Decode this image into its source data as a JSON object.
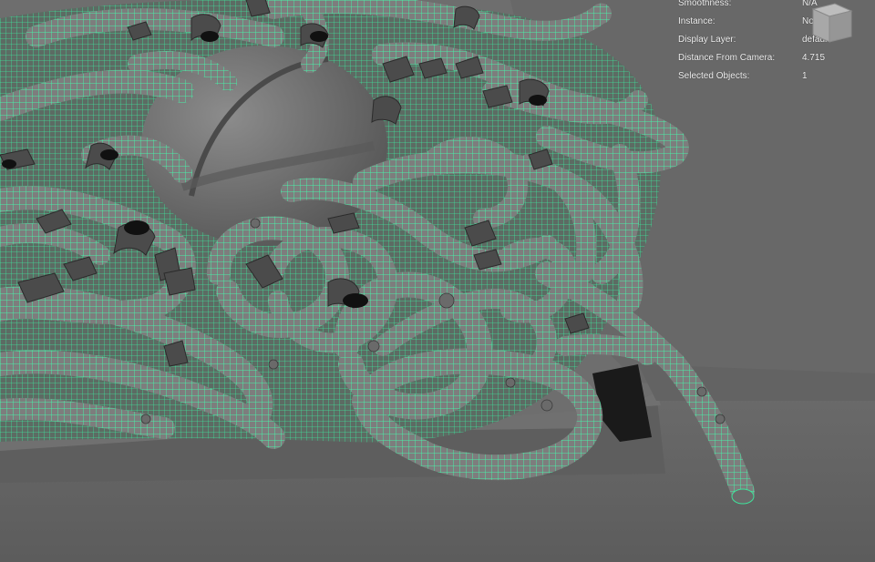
{
  "viewport": {
    "description_hidden": "",
    "colors": {
      "background": "#6d6d6d",
      "ground": "#646464",
      "wireframe": "#4dffb0",
      "surface": "#7a7a7a",
      "shadow": "#2a2a2a"
    }
  },
  "hud": {
    "rows": [
      {
        "label": "Smoothness:",
        "value": "N/A"
      },
      {
        "label": "Instance:",
        "value": "No"
      },
      {
        "label": "Display Layer:",
        "value": "default"
      },
      {
        "label": "Distance From Camera:",
        "value": "4.715"
      },
      {
        "label": "Selected Objects:",
        "value": "1"
      }
    ]
  },
  "viewcube": {
    "icon": "view-cube-icon"
  }
}
